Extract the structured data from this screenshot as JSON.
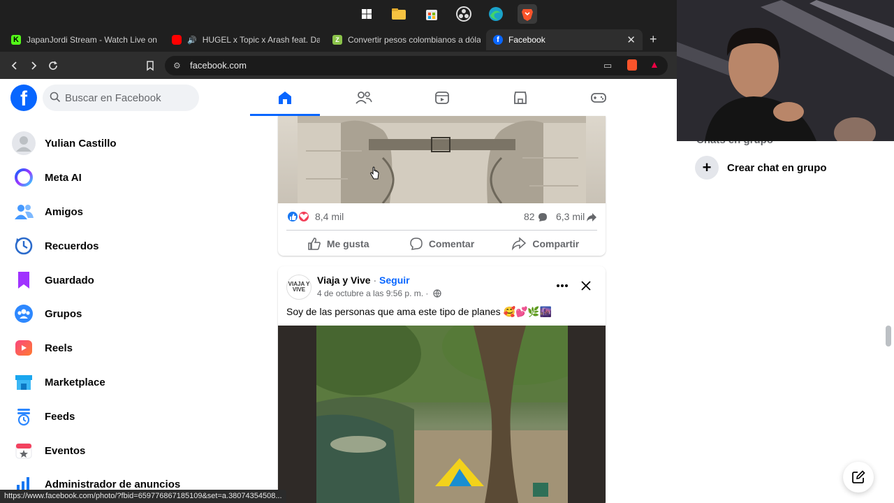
{
  "browser": {
    "tabs": [
      {
        "label": "JapanJordi Stream - Watch Live on Ki",
        "icon": "kick-icon",
        "color": "#53fc18"
      },
      {
        "label": "HUGEL x Topic x Arash feat. Daec",
        "icon": "youtube-icon",
        "color": "#ff0000"
      },
      {
        "label": "Convertir pesos colombianos a dólar",
        "icon": "converter-icon",
        "color": "#8bc34a"
      },
      {
        "label": "Facebook",
        "icon": "facebook-icon",
        "color": "#0866ff"
      }
    ],
    "url": "facebook.com",
    "status_url": "https://www.facebook.com/photo/?fbid=659776867185109&set=a.38074354508..."
  },
  "fb": {
    "search_placeholder": "Buscar en Facebook",
    "brand_color": "#0866ff",
    "nav_tabs": [
      "home-icon",
      "friends-icon",
      "video-icon",
      "marketplace-icon",
      "gaming-icon"
    ],
    "active_tab": "home-icon"
  },
  "sidebar": {
    "items": [
      {
        "label": "Yulian Castillo",
        "icon": "avatar-icon"
      },
      {
        "label": "Meta AI",
        "icon": "meta-ai-icon"
      },
      {
        "label": "Amigos",
        "icon": "friends-icon"
      },
      {
        "label": "Recuerdos",
        "icon": "memories-icon"
      },
      {
        "label": "Guardado",
        "icon": "saved-icon"
      },
      {
        "label": "Grupos",
        "icon": "groups-icon"
      },
      {
        "label": "Reels",
        "icon": "reels-icon"
      },
      {
        "label": "Marketplace",
        "icon": "marketplace-icon"
      },
      {
        "label": "Feeds",
        "icon": "feeds-icon"
      },
      {
        "label": "Eventos",
        "icon": "events-icon"
      },
      {
        "label": "Administrador de anuncios",
        "icon": "ads-manager-icon"
      }
    ]
  },
  "post1": {
    "reactions": "8,4 mil",
    "comments": "82",
    "shares": "6,3 mil",
    "like_label": "Me gusta",
    "comment_label": "Comentar",
    "share_label": "Compartir"
  },
  "post2": {
    "author": "Viaja y Vive",
    "separator": " · ",
    "follow": "Seguir",
    "date": "4 de octubre a las 9:56 p. m. ·",
    "text": "Soy de las personas que ama este tipo de planes 🥰💕🌿🌆",
    "avatar_text": "VIAJA Y VIVE"
  },
  "right": {
    "section_title": "Chats en grupo",
    "create_label": "Crear chat en grupo"
  }
}
